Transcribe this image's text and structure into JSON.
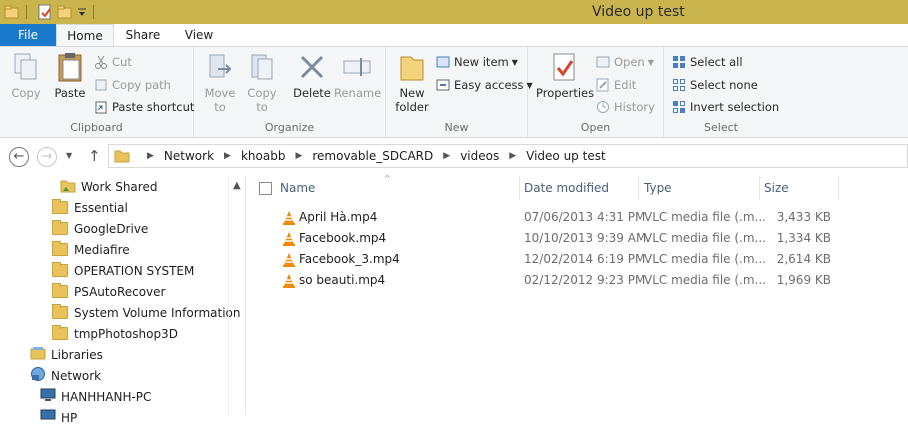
{
  "window": {
    "title": "Video up test"
  },
  "tabs": {
    "file": "File",
    "home": "Home",
    "share": "Share",
    "view": "View"
  },
  "ribbon": {
    "clipboard": {
      "label": "Clipboard",
      "copy": "Copy",
      "paste": "Paste",
      "cut": "Cut",
      "copy_path": "Copy path",
      "paste_shortcut": "Paste shortcut"
    },
    "organize": {
      "label": "Organize",
      "move_to": "Move",
      "move_to_2": "to",
      "copy_to": "Copy",
      "copy_to_2": "to",
      "delete": "Delete",
      "rename": "Rename"
    },
    "new": {
      "label": "New",
      "new_folder": "New",
      "new_folder_2": "folder",
      "new_item": "New item",
      "easy_access": "Easy access"
    },
    "open": {
      "label": "Open",
      "properties": "Properties",
      "open": "Open",
      "edit": "Edit",
      "history": "History"
    },
    "select": {
      "label": "Select",
      "select_all": "Select all",
      "select_none": "Select none",
      "invert_selection": "Invert selection"
    }
  },
  "address": {
    "crumbs": [
      "Network",
      "khoabb",
      "removable_SDCARD",
      "videos",
      "Video up test"
    ]
  },
  "nav": {
    "items": [
      {
        "label": "Work Shared"
      },
      {
        "label": "Essential"
      },
      {
        "label": "GoogleDrive"
      },
      {
        "label": "Mediafire"
      },
      {
        "label": "OPERATION SYSTEM"
      },
      {
        "label": "PSAutoRecover"
      },
      {
        "label": "System Volume Information"
      },
      {
        "label": "tmpPhotoshop3D"
      },
      {
        "label": "Libraries"
      },
      {
        "label": "Network"
      },
      {
        "label": "HANHHANH-PC"
      },
      {
        "label": "HP"
      }
    ]
  },
  "columns": {
    "name": "Name",
    "date": "Date modified",
    "type": "Type",
    "size": "Size"
  },
  "files": [
    {
      "name": "April Hà.mp4",
      "date": "07/06/2013 4:31 PM",
      "type": "VLC media file (.m...",
      "size": "3,433 KB"
    },
    {
      "name": "Facebook.mp4",
      "date": "10/10/2013 9:39 AM",
      "type": "VLC media file (.m...",
      "size": "1,334 KB"
    },
    {
      "name": "Facebook_3.mp4",
      "date": "12/02/2014 6:19 PM",
      "type": "VLC media file (.m...",
      "size": "2,614 KB"
    },
    {
      "name": "so beauti.mp4",
      "date": "02/12/2012 9:23 PM",
      "type": "VLC media file (.m...",
      "size": "1,969 KB"
    }
  ],
  "colors": {
    "file_tab": "#1979ca",
    "title_bar": "#c9b44e",
    "vlc_orange": "#f08a00"
  }
}
